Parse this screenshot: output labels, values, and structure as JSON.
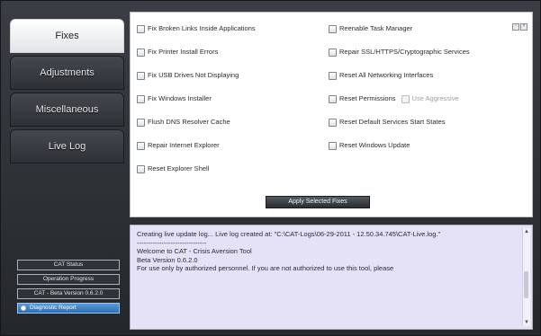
{
  "sidebar": {
    "items": [
      {
        "label": "Fixes",
        "active": true
      },
      {
        "label": "Adjustments",
        "active": false
      },
      {
        "label": "Miscellaneous",
        "active": false
      },
      {
        "label": "Live Log",
        "active": false
      }
    ]
  },
  "status": {
    "cat_status": "CAT Status",
    "operation_progress": "Operation Progress",
    "version": "CAT - Beta Version 0.6.2.0",
    "report": "Diagnostic Report"
  },
  "fixes": {
    "left": [
      "Fix Broken Links Inside Applications",
      "Fix Printer Install Errors",
      "Fix USB Drives Not Displaying",
      "Fix Windows Installer",
      "Flush DNS Resolver Cache",
      "Repair Internet Explorer",
      "Reset Explorer Shell"
    ],
    "right": [
      "Reenable Task Manager",
      "Repair SSL/HTTPS/Cryptographic Services",
      "Reset All Networking Interfaces",
      "Reset Permissions",
      "Reset Default Services Start States",
      "Reset Windows Update"
    ],
    "use_aggressive": "Use Aggressive",
    "apply_button": "Apply Selected Fixes"
  },
  "log": {
    "lines": [
      "Creating live update log... Live log created at: \"C:\\CAT-Logs\\06-29-2011 - 12.50.34.745\\CAT-Live.log.\"",
      "",
      "-------------------------------",
      "Welcome to CAT - Crisis Aversion Tool",
      "Beta Version 0.6.2.0",
      "",
      "For use only by authorized personnel. If you are not authorized to use this tool, please"
    ]
  }
}
